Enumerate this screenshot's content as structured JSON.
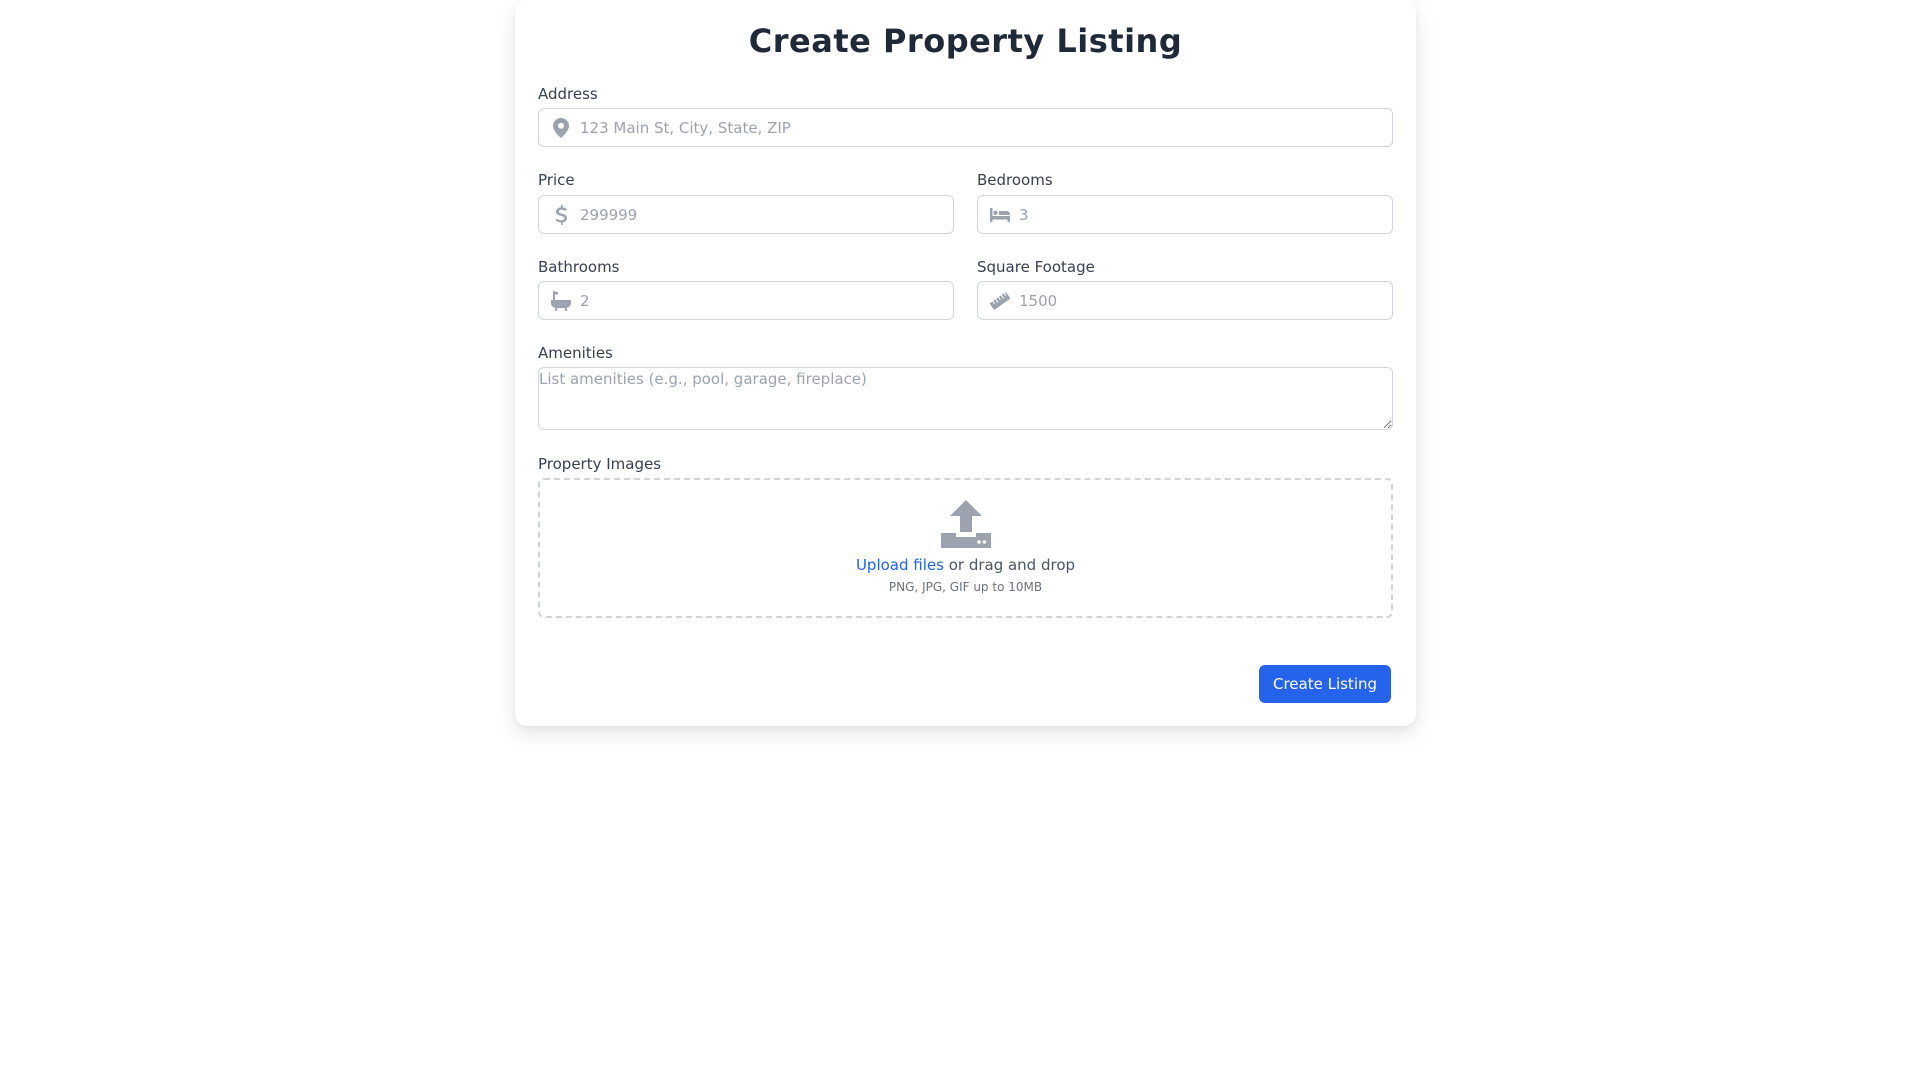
{
  "form": {
    "title": "Create Property Listing",
    "address": {
      "label": "Address",
      "placeholder": "123 Main St, City, State, ZIP",
      "icon": "map-pin-icon"
    },
    "price": {
      "label": "Price",
      "placeholder": "299999",
      "icon": "dollar-icon"
    },
    "bedrooms": {
      "label": "Bedrooms",
      "placeholder": "3",
      "icon": "bed-icon"
    },
    "bathrooms": {
      "label": "Bathrooms",
      "placeholder": "2",
      "icon": "bath-icon"
    },
    "square_footage": {
      "label": "Square Footage",
      "placeholder": "1500",
      "icon": "ruler-icon"
    },
    "amenities": {
      "label": "Amenities",
      "placeholder": "List amenities (e.g., pool, garage, fireplace)"
    },
    "images": {
      "label": "Property Images",
      "icon": "upload-icon",
      "upload_link": "Upload files",
      "upload_rest": " or drag and drop",
      "hint": "PNG, JPG, GIF up to 10MB"
    },
    "submit_label": "Create Listing"
  },
  "colors": {
    "primary": "#2563eb",
    "icon": "#9ca3af",
    "border": "#d1d5db",
    "title": "#1f2937"
  }
}
